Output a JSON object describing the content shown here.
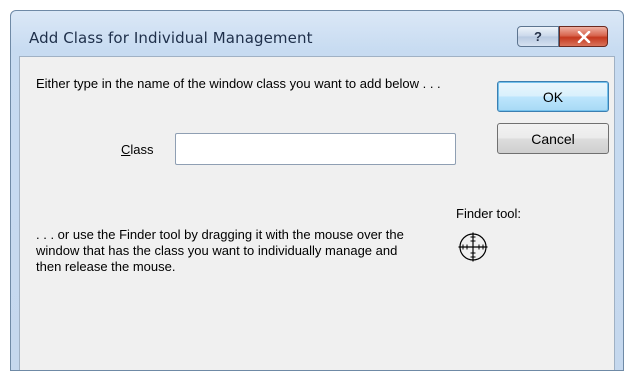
{
  "window": {
    "title": "Add Class for Individual Management",
    "help_label": "?",
    "close_label": "✕"
  },
  "dialog": {
    "instruction_top": "Either type in the name of the window class you want to add below . . .",
    "class_label_prefix": "C",
    "class_label_rest": "lass",
    "class_input_value": "",
    "instruction_bottom": ". . . or use the Finder tool by dragging it with the mouse over the window that has the class you want to individually manage and then release the mouse.",
    "finder_label": "Finder tool:",
    "finder_icon": "crosshair-icon"
  },
  "buttons": {
    "ok_label": "OK",
    "cancel_label": "Cancel"
  },
  "colors": {
    "titlebar": "#c7dbf1",
    "client": "#f0f0f0",
    "close": "#c5391f",
    "default_button_border": "#3c7fb1"
  }
}
